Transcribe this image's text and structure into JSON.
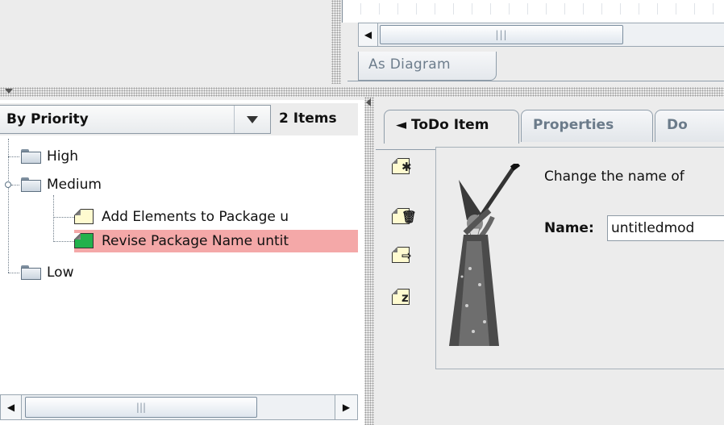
{
  "diagram": {
    "tab_label": "As Diagram"
  },
  "todo": {
    "perspective": "By Priority",
    "item_count": "2 Items",
    "tree": {
      "high": "High",
      "medium": "Medium",
      "item1": "Add Elements to Package u",
      "item2": "Revise Package Name untit",
      "low": "Low"
    }
  },
  "details": {
    "tabs": [
      "◄ ToDo Item",
      "Properties",
      "Do"
    ],
    "message": "Change the name of",
    "name_label": "Name:",
    "name_value": "untitledmod"
  },
  "colors": {
    "selection": "#f4a8a8",
    "resolved_note": "#22b14c",
    "open_note": "#fffbd0"
  }
}
